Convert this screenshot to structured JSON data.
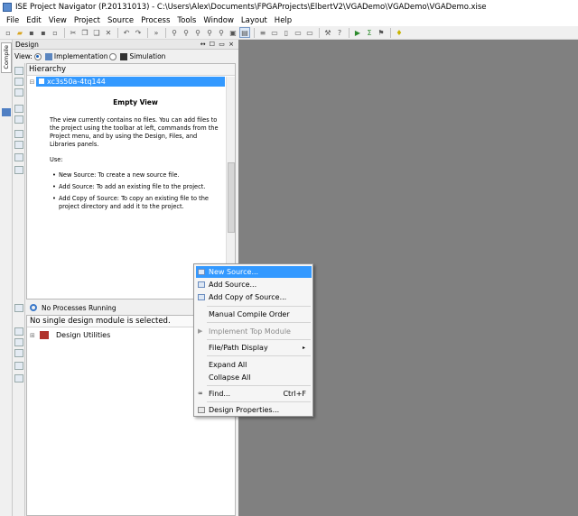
{
  "window": {
    "title": "ISE Project Navigator (P.20131013) - C:\\Users\\Alex\\Documents\\FPGAProjects\\ElbertV2\\VGADemo\\VGADemo\\VGADemo.xise"
  },
  "menubar": [
    "File",
    "Edit",
    "View",
    "Project",
    "Source",
    "Process",
    "Tools",
    "Window",
    "Layout",
    "Help"
  ],
  "left_strip": {
    "vertical_tab": "Compile"
  },
  "design_panel": {
    "header": "Design",
    "header_controls": "↔ ☐ ▭ ×",
    "view_label": "View:",
    "view_options": [
      "Implementation",
      "Simulation"
    ],
    "hierarchy_label": "Hierarchy",
    "device": "xc3s50a-4tq144",
    "empty_view": {
      "title": "Empty View",
      "intro": "The view currently contains no files. You can add files to the project using the toolbar at left, commands from the Project menu, and by using the Design, Files, and Libraries panels.",
      "use_label": "Use:",
      "items": [
        "New Source: To create a new source file.",
        "Add Source: To add an existing file to the project.",
        "Add Copy of Source: To copy an existing file to the project directory and add it to the project."
      ]
    }
  },
  "process_panel": {
    "status": "No Processes Running",
    "message": "No single design module is selected.",
    "tree_item": "Design Utilities"
  },
  "context_menu": {
    "items": [
      {
        "label": "New Source...",
        "highlighted": true
      },
      {
        "label": "Add Source..."
      },
      {
        "label": "Add Copy of Source..."
      },
      {
        "label": "Manual Compile Order"
      },
      {
        "label": "Implement Top Module",
        "disabled": true
      },
      {
        "label": "File/Path Display",
        "submenu_arrow": "▸"
      },
      {
        "label": "Expand All"
      },
      {
        "label": "Collapse All"
      },
      {
        "label": "Find...",
        "shortcut": "Ctrl+F"
      },
      {
        "label": "Design Properties..."
      }
    ]
  },
  "colors": {
    "selection": "#3399ff",
    "workspace": "#808080"
  }
}
